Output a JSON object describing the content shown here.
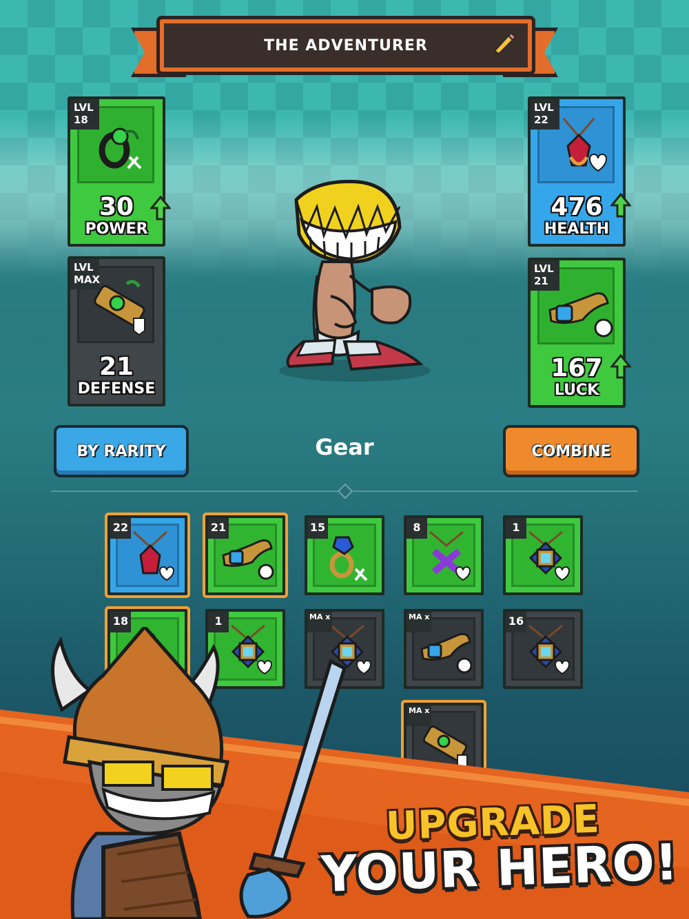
{
  "header": {
    "title": "THE ADVENTURER"
  },
  "stats": {
    "power": {
      "level_label": "LVL",
      "level": "18",
      "value": "30",
      "label": "POWER"
    },
    "health": {
      "level_label": "LVL",
      "level": "22",
      "value": "476",
      "label": "HEALTH"
    },
    "defense": {
      "level_label": "LVL",
      "level": "MAX",
      "value": "21",
      "label": "DEFENSE"
    },
    "luck": {
      "level_label": "LVL",
      "level": "21",
      "value": "167",
      "label": "LUCK"
    }
  },
  "controls": {
    "sort_button": "BY RARITY",
    "section_title": "Gear",
    "combine_button": "COMBINE"
  },
  "gear": [
    {
      "level": "22",
      "rarity": "blue",
      "item": "ruby-amulet",
      "selected": true
    },
    {
      "level": "21",
      "rarity": "green",
      "item": "horn-luck",
      "selected": true
    },
    {
      "level": "15",
      "rarity": "green",
      "item": "sapphire-ring",
      "selected": false
    },
    {
      "level": "8",
      "rarity": "green",
      "item": "cross-amulet",
      "selected": false
    },
    {
      "level": "1",
      "rarity": "green",
      "item": "square-amulet",
      "selected": false
    },
    {
      "level": "18",
      "rarity": "green",
      "item": "ring-power",
      "selected": true
    },
    {
      "level": "1",
      "rarity": "green",
      "item": "square-amulet",
      "selected": false
    },
    {
      "level": "MA x",
      "rarity": "gray",
      "item": "square-amulet",
      "selected": false
    },
    {
      "level": "MA x",
      "rarity": "gray",
      "item": "horn-luck",
      "selected": false
    },
    {
      "level": "16",
      "rarity": "gray",
      "item": "square-amulet",
      "selected": false
    },
    {
      "level": "MA x",
      "rarity": "gray",
      "item": "bracer-defense",
      "selected": true
    }
  ],
  "promo": {
    "line1": "UPGRADE",
    "line2": "YOUR HERO!"
  },
  "colors": {
    "green": "#3fc93f",
    "blue": "#35a6ea",
    "gray": "#3f4548",
    "orange": "#ef8a2c",
    "selected": "#f2a132"
  }
}
